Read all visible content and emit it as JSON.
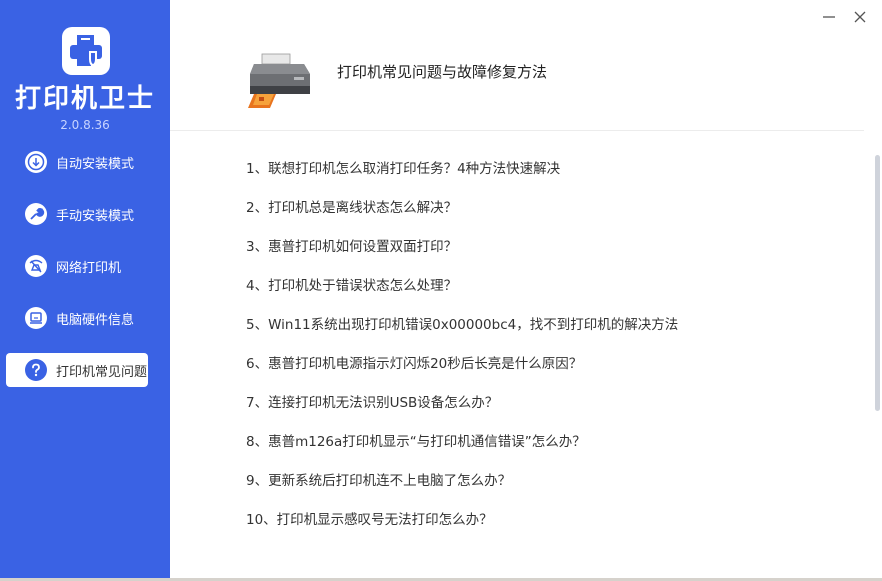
{
  "app": {
    "title": "打印机卫士",
    "version": "2.0.8.36",
    "accent_color": "#3a62e4"
  },
  "sidebar": {
    "items": [
      {
        "label": "自动安装模式",
        "icon": "download-circle-icon",
        "active": false
      },
      {
        "label": "手动安装模式",
        "icon": "wrench-icon",
        "active": false
      },
      {
        "label": "网络打印机",
        "icon": "network-printer-icon",
        "active": false
      },
      {
        "label": "电脑硬件信息",
        "icon": "computer-hardware-icon",
        "active": false
      },
      {
        "label": "打印机常见问题",
        "icon": "question-icon",
        "active": true
      }
    ]
  },
  "window_controls": {
    "minimize": "minimize-icon",
    "close": "close-icon"
  },
  "main": {
    "title": "打印机常见问题与故障修复方法",
    "faq": [
      "1、联想打印机怎么取消打印任务？4种方法快速解决",
      "2、打印机总是离线状态怎么解决？",
      "3、惠普打印机如何设置双面打印？",
      "4、打印机处于错误状态怎么处理？",
      "5、Win11系统出现打印机错误0x00000bc4，找不到打印机的解决方法",
      "6、惠普打印机电源指示灯闪烁20秒后长亮是什么原因？",
      "7、连接打印机无法识别USB设备怎么办？",
      "8、惠普m126a打印机显示“与打印机通信错误”怎么办？",
      "9、更新系统后打印机连不上电脑了怎么办？",
      "10、打印机显示感叹号无法打印怎么办？"
    ]
  }
}
